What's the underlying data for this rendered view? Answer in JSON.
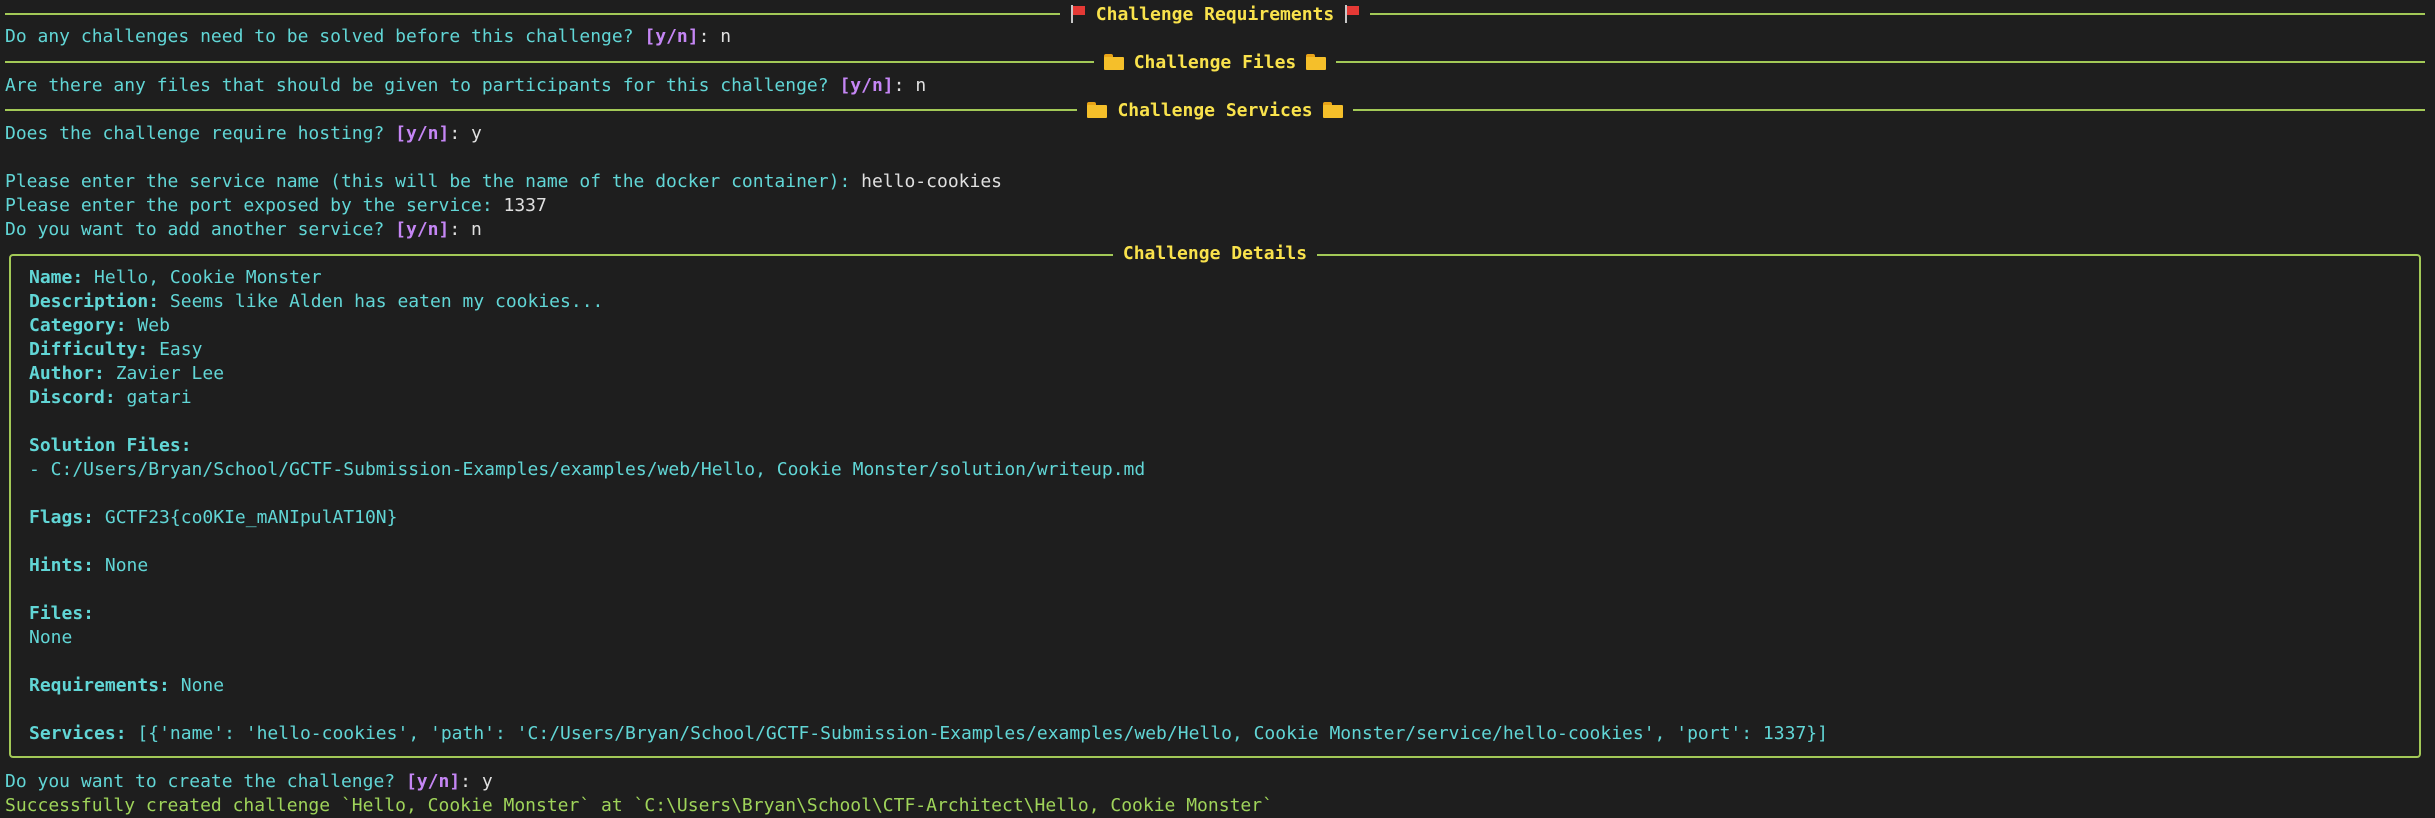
{
  "yn_hint": "[y/n]",
  "sections": {
    "requirements_title": "Challenge Requirements",
    "files_title": "Challenge Files",
    "services_title": "Challenge Services",
    "details_title": "Challenge Details"
  },
  "prompts": {
    "requirements_q": "Do any challenges need to be solved before this challenge? ",
    "requirements_a": "n",
    "files_q": "Are there any files that should be given to participants for this challenge? ",
    "files_a": "n",
    "hosting_q": "Does the challenge require hosting? ",
    "hosting_a": "y",
    "service_name_q": "Please enter the service name (this will be the name of the docker container): ",
    "service_name_a": "hello-cookies",
    "port_q": "Please enter the port exposed by the service: ",
    "port_a": "1337",
    "another_q": "Do you want to add another service? ",
    "another_a": "n",
    "create_q": "Do you want to create the challenge? ",
    "create_a": "y"
  },
  "details": {
    "name_label": "Name:",
    "name_value": "Hello, Cookie Monster",
    "description_label": "Description:",
    "description_value": "Seems like Alden has eaten my cookies...",
    "category_label": "Category:",
    "category_value": "Web",
    "difficulty_label": "Difficulty:",
    "difficulty_value": "Easy",
    "author_label": "Author:",
    "author_value": "Zavier Lee",
    "discord_label": "Discord:",
    "discord_value": "gatari",
    "solution_files_label": "Solution Files:",
    "solution_files_value": "- C:/Users/Bryan/School/GCTF-Submission-Examples/examples/web/Hello, Cookie Monster/solution/writeup.md",
    "flags_label": "Flags:",
    "flags_value": "GCTF23{co0KIe_mANIpulAT10N}",
    "hints_label": "Hints:",
    "hints_value": "None",
    "files_label": "Files:",
    "files_value": "None",
    "requirements_label": "Requirements:",
    "requirements_value": "None",
    "services_label": "Services:",
    "services_value": "[{'name': 'hello-cookies', 'path': 'C:/Users/Bryan/School/GCTF-Submission-Examples/examples/web/Hello, Cookie Monster/service/hello-cookies', 'port': 1337}]"
  },
  "result": "Successfully created challenge `Hello, Cookie Monster` at `C:\\Users\\Bryan\\School\\CTF-Architect\\Hello, Cookie Monster`",
  "colors": {
    "background": "#1e1e1e",
    "cyan": "#61d6d6",
    "purple": "#c586f5",
    "yellow": "#f9e24c",
    "green": "#9fd45a",
    "rule": "#a3c957"
  },
  "icons": {
    "requirements": "red-flag-icon",
    "files_services": "folder-icon"
  }
}
